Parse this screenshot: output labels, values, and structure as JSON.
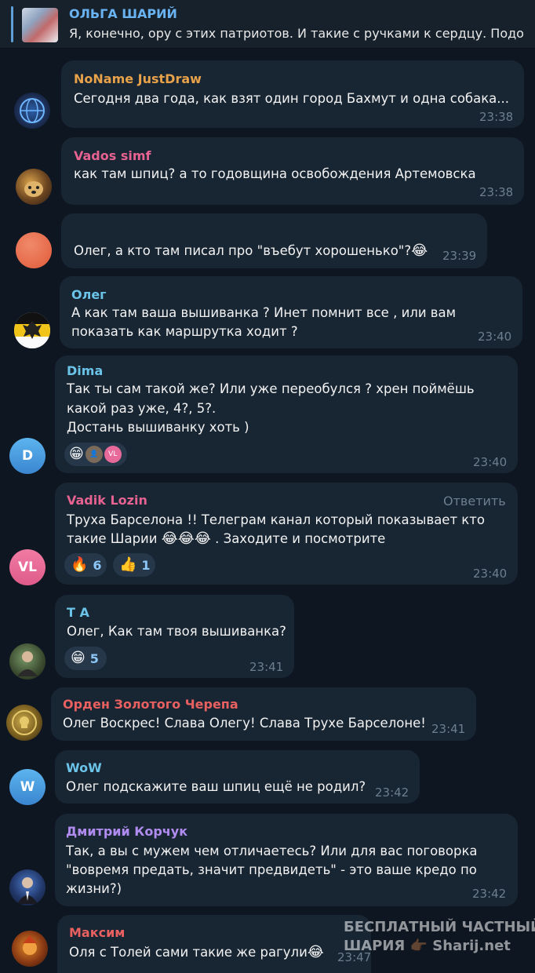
{
  "pinned": {
    "author": "ОЛЬГА ШАРИЙ",
    "text": "Я, конечно, ору с этих патриотов. И такие с ручками к сердцу.   Подо"
  },
  "messages": [
    {
      "author": "NoName JustDraw",
      "author_color": "#e8a24a",
      "lines": [
        "Сегодня два года, как взят один город Бахмут и одна собака..."
      ],
      "time": "23:38",
      "avatar_icon": "globe-icon"
    },
    {
      "author": "Vados simf",
      "author_color": "#e66391",
      "lines": [
        "как там шпиц? а то годовщина освобождения Артемовска"
      ],
      "time": "23:38",
      "avatar_icon": "dog-icon"
    },
    {
      "author": "",
      "lines": [
        "Олег, а кто там писал про \"въебут хорошенько\"?"
      ],
      "time": "23:39",
      "avatar_icon": "blank-avatar"
    },
    {
      "author": "Олег",
      "author_color": "#6bc4e8",
      "lines": [
        "А как там ваша вышиванка ? Инет помнит все , или вам",
        "показать как маршрутка ходит ?"
      ],
      "time": "23:40",
      "avatar_icon": "eagle-icon"
    },
    {
      "author": "Dima",
      "author_color": "#6bc4e8",
      "avatar_letter": "D",
      "lines": [
        "Так ты сам такой же? Или уже переобулся ? хрен поймёшь",
        "какой раз уже, 4?, 5?.",
        "Достань вышиванку хоть )"
      ],
      "time": "23:40",
      "reaction_avatar_letter": "VL"
    },
    {
      "author": "Vadik Lozin",
      "author_color": "#e66391",
      "avatar_letter": "VL",
      "reply_label": "Ответить",
      "lines": [
        "Труха Барселона !! Телеграм канал который показывает кто",
        "такие Шарии",
        " . Заходите и посмотрите"
      ],
      "time": "23:40",
      "reactions": [
        {
          "icon": "fire-icon",
          "count": "6"
        },
        {
          "icon": "thumbs-up-icon",
          "count": "1"
        }
      ]
    },
    {
      "author": "T A",
      "author_color": "#6bc4e8",
      "lines": [
        "Олег, Как там твоя вышиванка?"
      ],
      "time": "23:41",
      "reactions": [
        {
          "icon": "grin-icon",
          "count": "5"
        }
      ]
    },
    {
      "author": "Орден Золотого Черепа",
      "author_color": "#e86060",
      "lines": [
        "Олег Воскрес! Слава Олегу! Слава Трухе Барселоне!"
      ],
      "time": "23:41",
      "avatar_icon": "skull-coin-icon"
    },
    {
      "author": "WoW",
      "author_color": "#6bc4e8",
      "avatar_letter": "W",
      "lines": [
        "Олег подскажите ваш шпиц ещё не родил?"
      ],
      "time": "23:42"
    },
    {
      "author": "Дмитрий Корчук",
      "author_color": "#b18cf0",
      "lines": [
        "Так, а вы с мужем чем отличаетесь? Или для вас поговорка",
        "\"вовремя предать, значит предвидеть\" - это ваше кредо по",
        "жизни?)"
      ],
      "time": "23:42"
    },
    {
      "author": "Максим",
      "author_color": "#e86060",
      "lines": [
        "Оля с Толей сами такие же рагули"
      ],
      "time": "23:47"
    }
  ],
  "watermark": {
    "line1": "БЕСПЛАТНЫЙ  ЧАСТНЫЙ",
    "line2": "ШАРИЯ",
    "line3": "Sharij.net"
  },
  "colors": {
    "background": "#0e1621",
    "bubble": "#182533",
    "time": "#6d7f8f",
    "reaction_bg": "#26374a",
    "reaction_count": "#8cc6f7"
  }
}
